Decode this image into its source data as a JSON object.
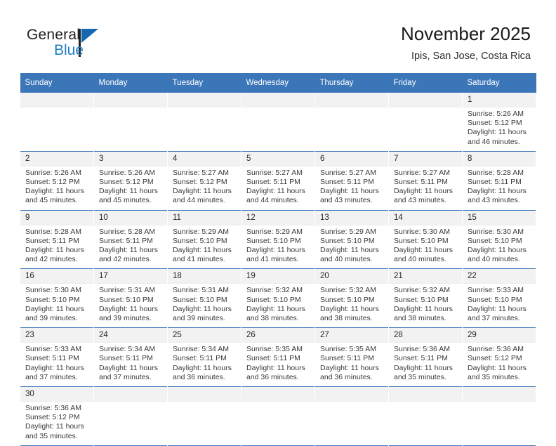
{
  "brand": {
    "logo_text_top": "General",
    "logo_text_bottom": "Blue",
    "logo_color_dark": "#231f20",
    "logo_color_blue": "#1668b3"
  },
  "header": {
    "title": "November 2025",
    "subtitle": "Ipis, San Jose, Costa Rica"
  },
  "theme": {
    "header_blue": "#3b76b9",
    "daynum_band": "#f2f2f2",
    "text": "#3a3a3a"
  },
  "weekdays": [
    "Sunday",
    "Monday",
    "Tuesday",
    "Wednesday",
    "Thursday",
    "Friday",
    "Saturday"
  ],
  "weeks": [
    [
      {
        "day": "",
        "blank": true,
        "sunrise": "",
        "sunset": "",
        "daylight": ""
      },
      {
        "day": "",
        "blank": true,
        "sunrise": "",
        "sunset": "",
        "daylight": ""
      },
      {
        "day": "",
        "blank": true,
        "sunrise": "",
        "sunset": "",
        "daylight": ""
      },
      {
        "day": "",
        "blank": true,
        "sunrise": "",
        "sunset": "",
        "daylight": ""
      },
      {
        "day": "",
        "blank": true,
        "sunrise": "",
        "sunset": "",
        "daylight": ""
      },
      {
        "day": "",
        "blank": true,
        "sunrise": "",
        "sunset": "",
        "daylight": ""
      },
      {
        "day": "1",
        "blank": false,
        "sunrise": "Sunrise: 5:26 AM",
        "sunset": "Sunset: 5:12 PM",
        "daylight": "Daylight: 11 hours and 46 minutes."
      }
    ],
    [
      {
        "day": "2",
        "blank": false,
        "sunrise": "Sunrise: 5:26 AM",
        "sunset": "Sunset: 5:12 PM",
        "daylight": "Daylight: 11 hours and 45 minutes."
      },
      {
        "day": "3",
        "blank": false,
        "sunrise": "Sunrise: 5:26 AM",
        "sunset": "Sunset: 5:12 PM",
        "daylight": "Daylight: 11 hours and 45 minutes."
      },
      {
        "day": "4",
        "blank": false,
        "sunrise": "Sunrise: 5:27 AM",
        "sunset": "Sunset: 5:12 PM",
        "daylight": "Daylight: 11 hours and 44 minutes."
      },
      {
        "day": "5",
        "blank": false,
        "sunrise": "Sunrise: 5:27 AM",
        "sunset": "Sunset: 5:11 PM",
        "daylight": "Daylight: 11 hours and 44 minutes."
      },
      {
        "day": "6",
        "blank": false,
        "sunrise": "Sunrise: 5:27 AM",
        "sunset": "Sunset: 5:11 PM",
        "daylight": "Daylight: 11 hours and 43 minutes."
      },
      {
        "day": "7",
        "blank": false,
        "sunrise": "Sunrise: 5:27 AM",
        "sunset": "Sunset: 5:11 PM",
        "daylight": "Daylight: 11 hours and 43 minutes."
      },
      {
        "day": "8",
        "blank": false,
        "sunrise": "Sunrise: 5:28 AM",
        "sunset": "Sunset: 5:11 PM",
        "daylight": "Daylight: 11 hours and 43 minutes."
      }
    ],
    [
      {
        "day": "9",
        "blank": false,
        "sunrise": "Sunrise: 5:28 AM",
        "sunset": "Sunset: 5:11 PM",
        "daylight": "Daylight: 11 hours and 42 minutes."
      },
      {
        "day": "10",
        "blank": false,
        "sunrise": "Sunrise: 5:28 AM",
        "sunset": "Sunset: 5:11 PM",
        "daylight": "Daylight: 11 hours and 42 minutes."
      },
      {
        "day": "11",
        "blank": false,
        "sunrise": "Sunrise: 5:29 AM",
        "sunset": "Sunset: 5:10 PM",
        "daylight": "Daylight: 11 hours and 41 minutes."
      },
      {
        "day": "12",
        "blank": false,
        "sunrise": "Sunrise: 5:29 AM",
        "sunset": "Sunset: 5:10 PM",
        "daylight": "Daylight: 11 hours and 41 minutes."
      },
      {
        "day": "13",
        "blank": false,
        "sunrise": "Sunrise: 5:29 AM",
        "sunset": "Sunset: 5:10 PM",
        "daylight": "Daylight: 11 hours and 40 minutes."
      },
      {
        "day": "14",
        "blank": false,
        "sunrise": "Sunrise: 5:30 AM",
        "sunset": "Sunset: 5:10 PM",
        "daylight": "Daylight: 11 hours and 40 minutes."
      },
      {
        "day": "15",
        "blank": false,
        "sunrise": "Sunrise: 5:30 AM",
        "sunset": "Sunset: 5:10 PM",
        "daylight": "Daylight: 11 hours and 40 minutes."
      }
    ],
    [
      {
        "day": "16",
        "blank": false,
        "sunrise": "Sunrise: 5:30 AM",
        "sunset": "Sunset: 5:10 PM",
        "daylight": "Daylight: 11 hours and 39 minutes."
      },
      {
        "day": "17",
        "blank": false,
        "sunrise": "Sunrise: 5:31 AM",
        "sunset": "Sunset: 5:10 PM",
        "daylight": "Daylight: 11 hours and 39 minutes."
      },
      {
        "day": "18",
        "blank": false,
        "sunrise": "Sunrise: 5:31 AM",
        "sunset": "Sunset: 5:10 PM",
        "daylight": "Daylight: 11 hours and 39 minutes."
      },
      {
        "day": "19",
        "blank": false,
        "sunrise": "Sunrise: 5:32 AM",
        "sunset": "Sunset: 5:10 PM",
        "daylight": "Daylight: 11 hours and 38 minutes."
      },
      {
        "day": "20",
        "blank": false,
        "sunrise": "Sunrise: 5:32 AM",
        "sunset": "Sunset: 5:10 PM",
        "daylight": "Daylight: 11 hours and 38 minutes."
      },
      {
        "day": "21",
        "blank": false,
        "sunrise": "Sunrise: 5:32 AM",
        "sunset": "Sunset: 5:10 PM",
        "daylight": "Daylight: 11 hours and 38 minutes."
      },
      {
        "day": "22",
        "blank": false,
        "sunrise": "Sunrise: 5:33 AM",
        "sunset": "Sunset: 5:10 PM",
        "daylight": "Daylight: 11 hours and 37 minutes."
      }
    ],
    [
      {
        "day": "23",
        "blank": false,
        "sunrise": "Sunrise: 5:33 AM",
        "sunset": "Sunset: 5:11 PM",
        "daylight": "Daylight: 11 hours and 37 minutes."
      },
      {
        "day": "24",
        "blank": false,
        "sunrise": "Sunrise: 5:34 AM",
        "sunset": "Sunset: 5:11 PM",
        "daylight": "Daylight: 11 hours and 37 minutes."
      },
      {
        "day": "25",
        "blank": false,
        "sunrise": "Sunrise: 5:34 AM",
        "sunset": "Sunset: 5:11 PM",
        "daylight": "Daylight: 11 hours and 36 minutes."
      },
      {
        "day": "26",
        "blank": false,
        "sunrise": "Sunrise: 5:35 AM",
        "sunset": "Sunset: 5:11 PM",
        "daylight": "Daylight: 11 hours and 36 minutes."
      },
      {
        "day": "27",
        "blank": false,
        "sunrise": "Sunrise: 5:35 AM",
        "sunset": "Sunset: 5:11 PM",
        "daylight": "Daylight: 11 hours and 36 minutes."
      },
      {
        "day": "28",
        "blank": false,
        "sunrise": "Sunrise: 5:36 AM",
        "sunset": "Sunset: 5:11 PM",
        "daylight": "Daylight: 11 hours and 35 minutes."
      },
      {
        "day": "29",
        "blank": false,
        "sunrise": "Sunrise: 5:36 AM",
        "sunset": "Sunset: 5:12 PM",
        "daylight": "Daylight: 11 hours and 35 minutes."
      }
    ],
    [
      {
        "day": "30",
        "blank": false,
        "sunrise": "Sunrise: 5:36 AM",
        "sunset": "Sunset: 5:12 PM",
        "daylight": "Daylight: 11 hours and 35 minutes."
      },
      {
        "day": "",
        "blank": true,
        "sunrise": "",
        "sunset": "",
        "daylight": ""
      },
      {
        "day": "",
        "blank": true,
        "sunrise": "",
        "sunset": "",
        "daylight": ""
      },
      {
        "day": "",
        "blank": true,
        "sunrise": "",
        "sunset": "",
        "daylight": ""
      },
      {
        "day": "",
        "blank": true,
        "sunrise": "",
        "sunset": "",
        "daylight": ""
      },
      {
        "day": "",
        "blank": true,
        "sunrise": "",
        "sunset": "",
        "daylight": ""
      },
      {
        "day": "",
        "blank": true,
        "sunrise": "",
        "sunset": "",
        "daylight": ""
      }
    ]
  ]
}
